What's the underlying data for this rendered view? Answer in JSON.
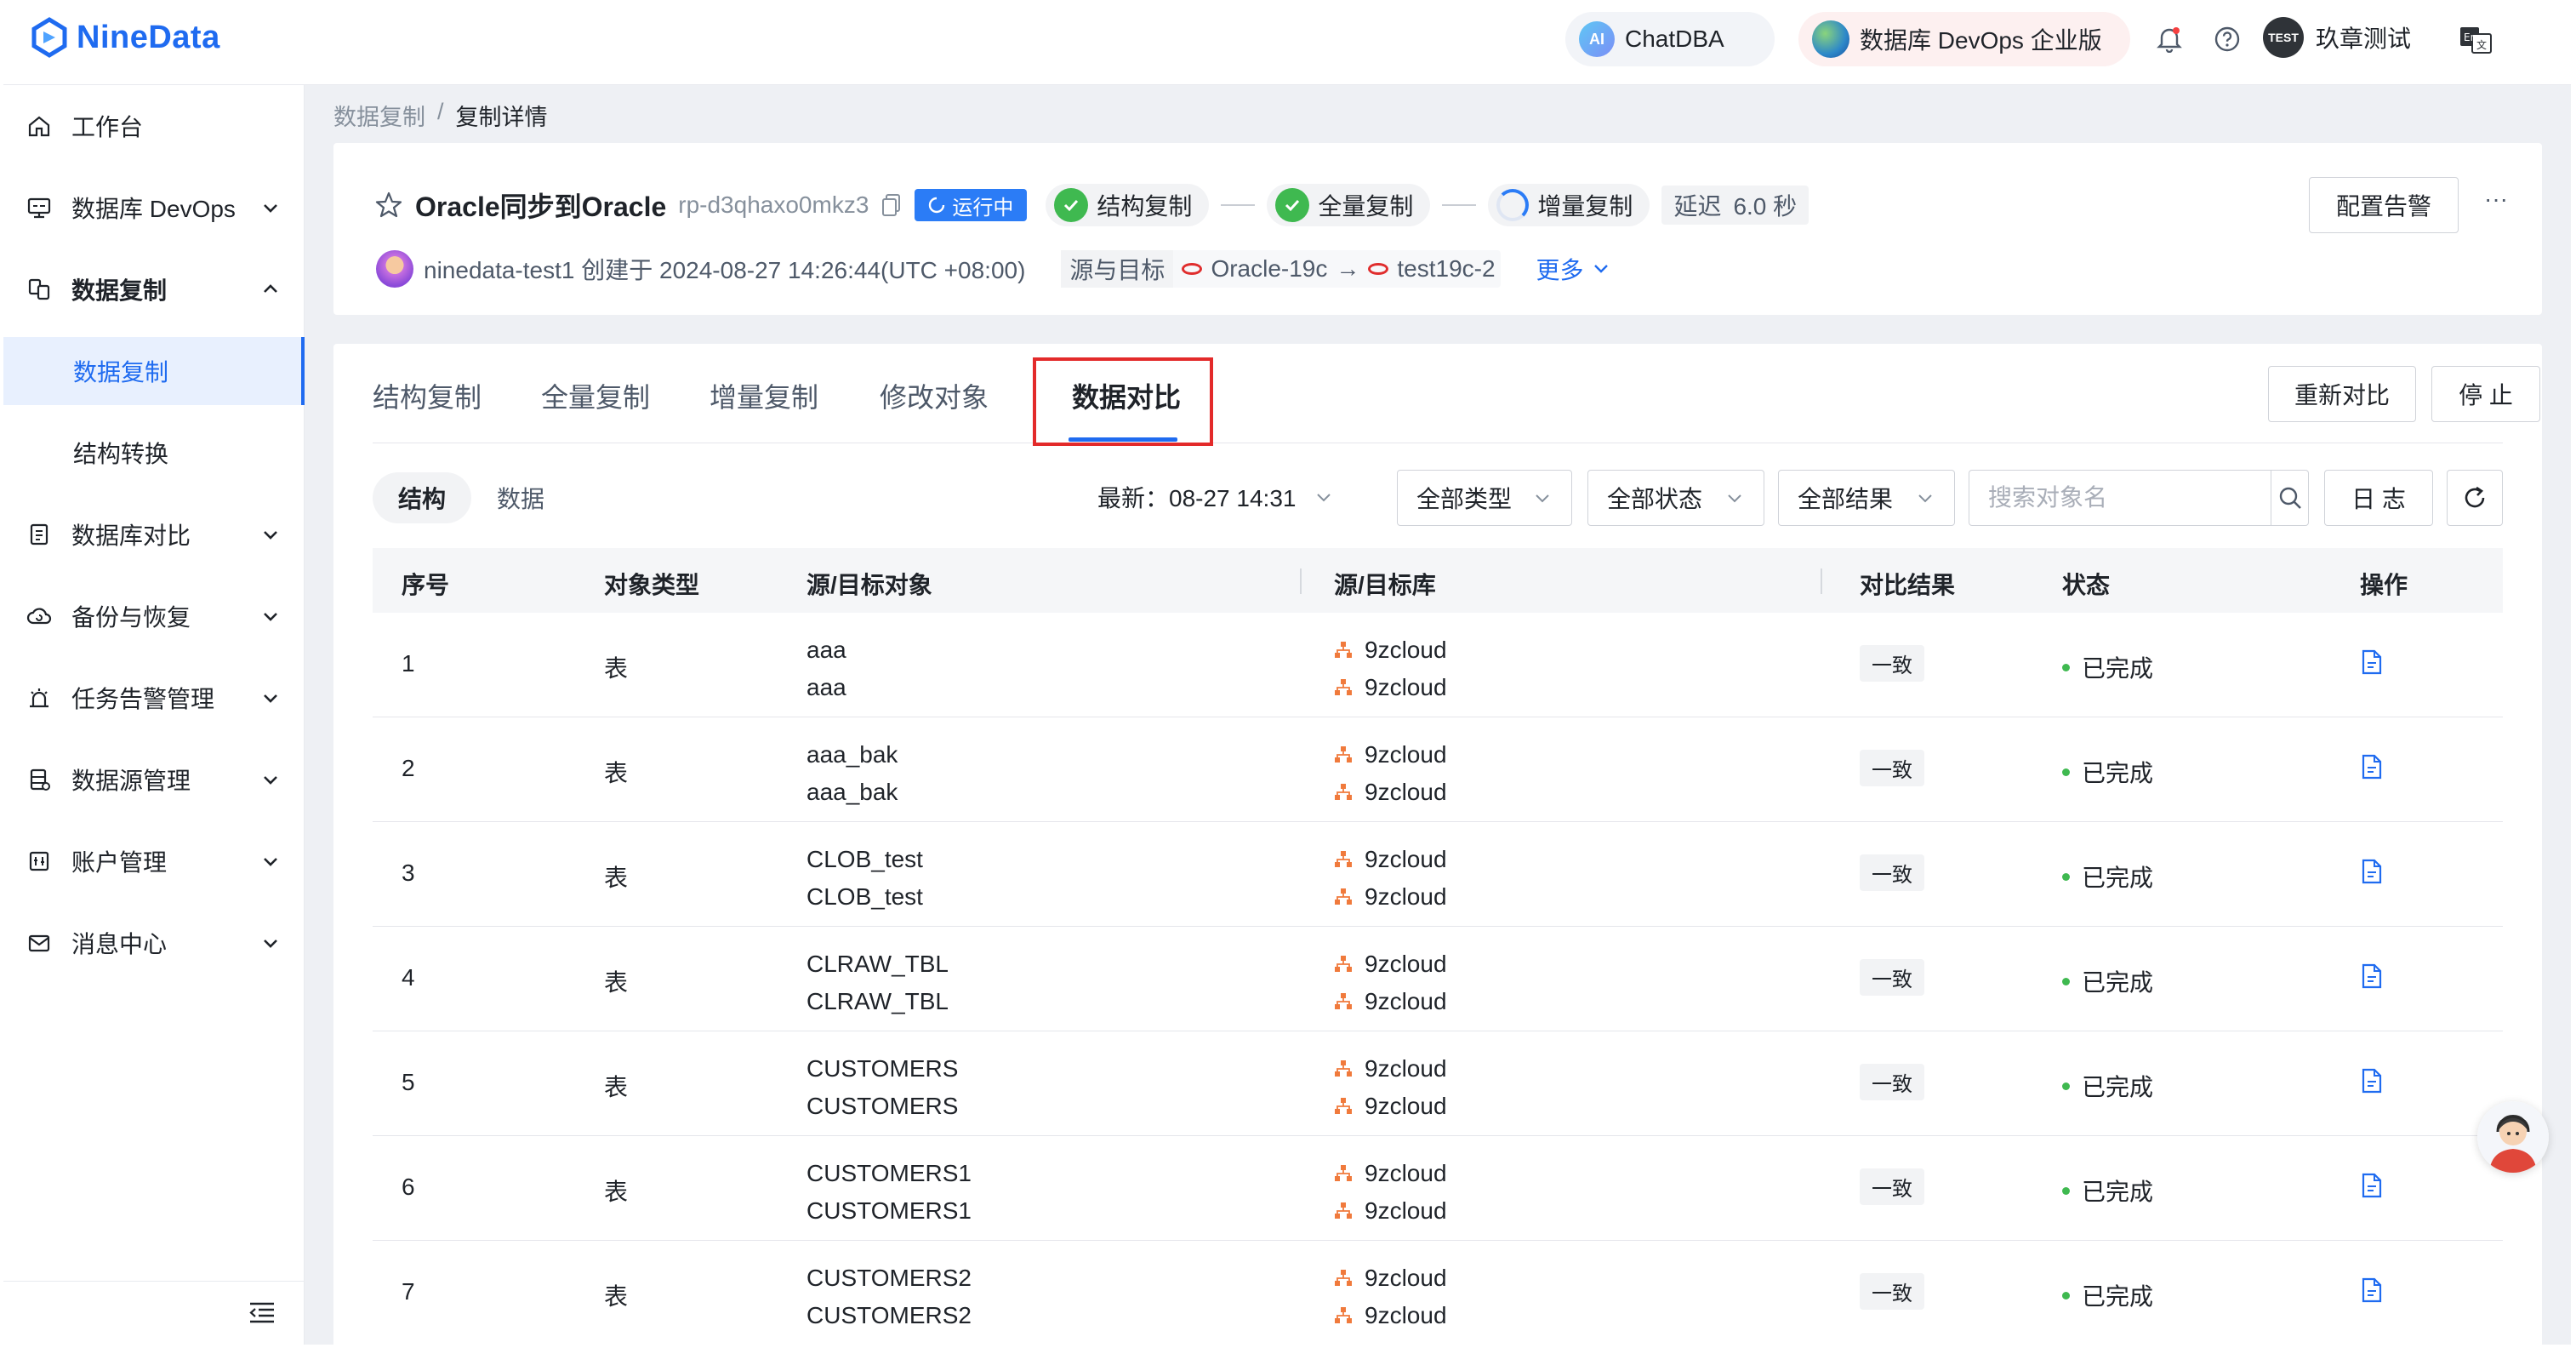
{
  "header": {
    "logo_text": "NineData",
    "chatdba": "ChatDBA",
    "ai_badge": "AI",
    "devops": "数据库 DevOps 企业版",
    "user_badge": "TEST",
    "user_name": "玖章测试"
  },
  "sidebar": {
    "items": [
      {
        "label": "工作台",
        "icon": "home-icon"
      },
      {
        "label": "数据库 DevOps",
        "icon": "monitor-icon"
      },
      {
        "label": "数据复制",
        "icon": "replication-icon"
      },
      {
        "label": "数据复制",
        "icon": ""
      },
      {
        "label": "结构转换",
        "icon": ""
      },
      {
        "label": "数据库对比",
        "icon": "compare-icon"
      },
      {
        "label": "备份与恢复",
        "icon": "cloud-backup-icon"
      },
      {
        "label": "任务告警管理",
        "icon": "alarm-icon"
      },
      {
        "label": "数据源管理",
        "icon": "datasource-icon"
      },
      {
        "label": "账户管理",
        "icon": "account-icon"
      },
      {
        "label": "消息中心",
        "icon": "mail-icon"
      }
    ]
  },
  "breadcrumb": {
    "parent": "数据复制",
    "sep": "/",
    "current": "复制详情"
  },
  "task": {
    "name": "Oracle同步到Oracle",
    "id": "rp-d3qhaxo0mkz3",
    "status": "运行中",
    "steps": [
      "结构复制",
      "全量复制",
      "增量复制"
    ],
    "delay_label": "延迟",
    "delay_value": "6.0 秒",
    "alert_button": "配置告警",
    "more_dots": "···",
    "creator": "ninedata-test1 创建于 2024-08-27 14:26:44(UTC +08:00)",
    "src_target_label": "源与目标",
    "source": "Oracle-19c",
    "arrow": "→",
    "target": "test19c-2",
    "more": "更多"
  },
  "tabs": {
    "items": [
      "结构复制",
      "全量复制",
      "增量复制",
      "修改对象",
      "数据对比"
    ],
    "active": "数据对比",
    "recompare": "重新对比",
    "stop": "停 止"
  },
  "toolbar": {
    "seg_structure": "结构",
    "seg_data": "数据",
    "latest": "最新：08-27 14:31",
    "type_filter": "全部类型",
    "status_filter": "全部状态",
    "result_filter": "全部结果",
    "search_placeholder": "搜索对象名",
    "log": "日 志"
  },
  "table": {
    "headers": [
      "序号",
      "对象类型",
      "源/目标对象",
      "源/目标库",
      "对比结果",
      "状态",
      "操作"
    ],
    "rows": [
      {
        "seq": "1",
        "type": "表",
        "src_obj": "aaa",
        "tgt_obj": "aaa",
        "src_db": "9zcloud",
        "tgt_db": "9zcloud",
        "result": "一致",
        "status": "已完成"
      },
      {
        "seq": "2",
        "type": "表",
        "src_obj": "aaa_bak",
        "tgt_obj": "aaa_bak",
        "src_db": "9zcloud",
        "tgt_db": "9zcloud",
        "result": "一致",
        "status": "已完成"
      },
      {
        "seq": "3",
        "type": "表",
        "src_obj": "CLOB_test",
        "tgt_obj": "CLOB_test",
        "src_db": "9zcloud",
        "tgt_db": "9zcloud",
        "result": "一致",
        "status": "已完成"
      },
      {
        "seq": "4",
        "type": "表",
        "src_obj": "CLRAW_TBL",
        "tgt_obj": "CLRAW_TBL",
        "src_db": "9zcloud",
        "tgt_db": "9zcloud",
        "result": "一致",
        "status": "已完成"
      },
      {
        "seq": "5",
        "type": "表",
        "src_obj": "CUSTOMERS",
        "tgt_obj": "CUSTOMERS",
        "src_db": "9zcloud",
        "tgt_db": "9zcloud",
        "result": "一致",
        "status": "已完成"
      },
      {
        "seq": "6",
        "type": "表",
        "src_obj": "CUSTOMERS1",
        "tgt_obj": "CUSTOMERS1",
        "src_db": "9zcloud",
        "tgt_db": "9zcloud",
        "result": "一致",
        "status": "已完成"
      },
      {
        "seq": "7",
        "type": "表",
        "src_obj": "CUSTOMERS2",
        "tgt_obj": "CUSTOMERS2",
        "src_db": "9zcloud",
        "tgt_db": "9zcloud",
        "result": "一致",
        "status": "已完成"
      }
    ]
  },
  "colors": {
    "brand": "#1f6bf0",
    "success": "#3fb950",
    "highlight": "#e32a2a",
    "oracle": "#e02d2d",
    "db_icon": "#f07a3c"
  }
}
